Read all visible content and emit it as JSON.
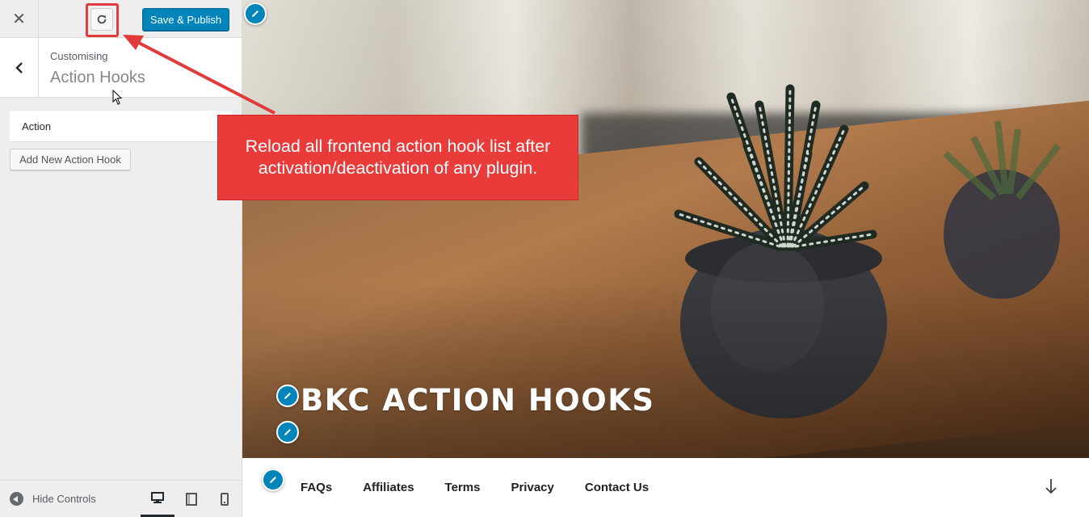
{
  "customizer": {
    "close_label": "✕",
    "reload_tooltip": "Reload action hooks",
    "publish_label": "Save & Publish",
    "breadcrumb": "Customising",
    "section_title": "Action Hooks",
    "action_select_value": "Action",
    "add_button_label": "Add New Action Hook",
    "hide_controls_label": "Hide Controls",
    "devices": [
      "desktop",
      "tablet",
      "mobile"
    ],
    "active_device": "desktop"
  },
  "annotation": {
    "text_line1": "Reload all frontend action hook list after",
    "text_line2": "activation/deactivation of any plugin."
  },
  "preview": {
    "site_title": "BKC ACTION HOOKS",
    "menu": [
      "FAQs",
      "Affiliates",
      "Terms",
      "Privacy",
      "Contact Us"
    ]
  },
  "colors": {
    "primary_button": "#0085ba",
    "annotation_red": "#ea3b3b",
    "sidebar_bg": "#eeeeee"
  },
  "icons": {
    "close": "close-icon",
    "reload": "reload-icon",
    "back": "chevron-left-icon",
    "edit": "pencil-icon",
    "scroll": "arrow-down-icon"
  }
}
